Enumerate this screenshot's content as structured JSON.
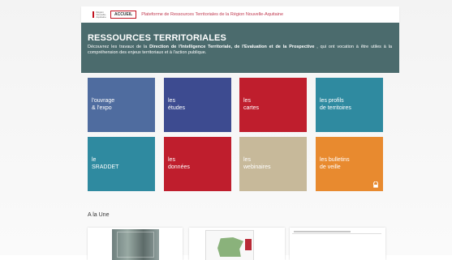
{
  "topbar": {
    "logo_text": "Région Nouvelle-Aquitaine",
    "accueil": "ACCUEIL",
    "platform": "Plateforme de Ressources Territoriales de la Région Nouvelle-Aquitaine"
  },
  "header": {
    "title": "RESSOURCES TERRITORIALES",
    "desc_1": "Découvrez les travaux de la",
    "desc_bold": "Direction de l'Intelligence Territoriale, de l'Evaluation et de la Prospective",
    "desc_2": ", qui ont vocation à être utiles à la compréhension des enjeux territoriaux et à l'action publique."
  },
  "tiles": [
    {
      "l1": "l'ouvrage",
      "l2": "& l'expo",
      "color": "#4f6c9f"
    },
    {
      "l1": "les",
      "l2": "études",
      "color": "#3d4b90"
    },
    {
      "l1": "les",
      "l2": "cartes",
      "color": "#bf1e2d"
    },
    {
      "l1": "les profils",
      "l2": "de territoires",
      "color": "#2f8aa0"
    },
    {
      "l1": "le",
      "l2": "SRADDET",
      "color": "#2f8aa0"
    },
    {
      "l1": "les",
      "l2": "données",
      "color": "#bf1e2d"
    },
    {
      "l1": "les",
      "l2": "webinaires",
      "color": "#c7b99a"
    },
    {
      "l1": "les bulletins",
      "l2": "de veille",
      "color": "#e88a2f"
    }
  ],
  "section_title": "A la Une"
}
